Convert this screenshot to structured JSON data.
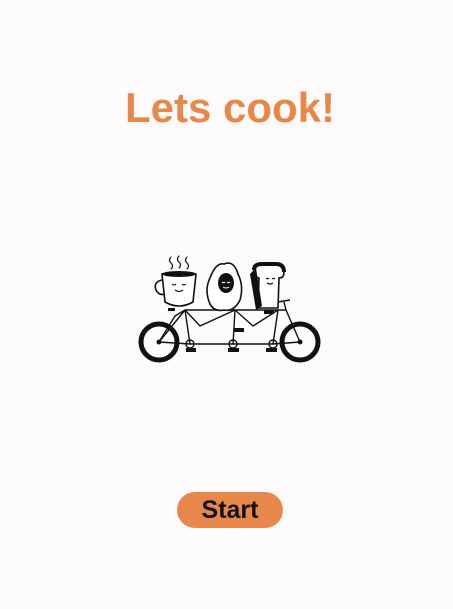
{
  "page": {
    "title": "Lets cook!"
  },
  "illustration": {
    "icon": "tandem-bike-breakfast-illustration",
    "characters": [
      "coffee-cup-character",
      "fried-egg-character",
      "toast-character"
    ]
  },
  "actions": {
    "start_label": "Start"
  },
  "colors": {
    "accent": "#e8874a",
    "background": "#fdfafc",
    "button_text": "#111111"
  }
}
